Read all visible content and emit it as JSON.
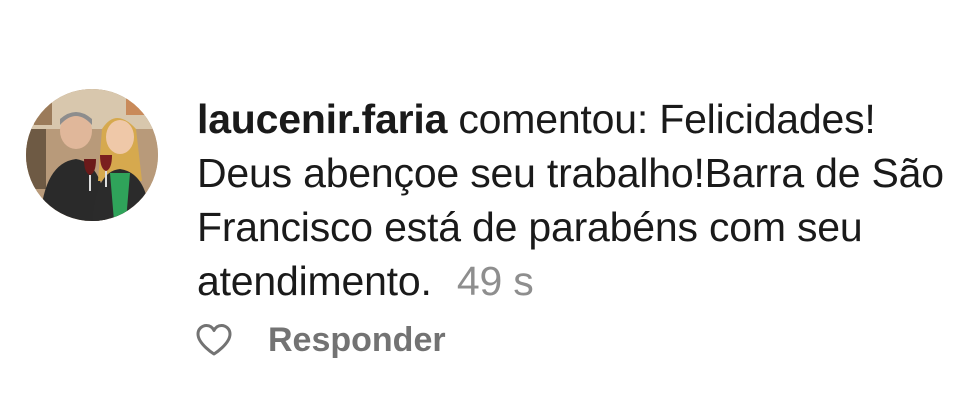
{
  "comment": {
    "username": "laucenir.faria",
    "action_text": "comentou:",
    "text": "Felicidades! Deus abençoe seu trabalho!Barra de São Francisco está de parabéns com seu atendimento.",
    "timestamp": "49 s",
    "avatar_icon": "profile-photo"
  },
  "actions": {
    "like_icon": "heart-outline-icon",
    "reply_label": "Responder"
  },
  "colors": {
    "text": "#1a1a1a",
    "muted": "#8e8e8e",
    "reply": "#737373",
    "background": "#ffffff"
  }
}
